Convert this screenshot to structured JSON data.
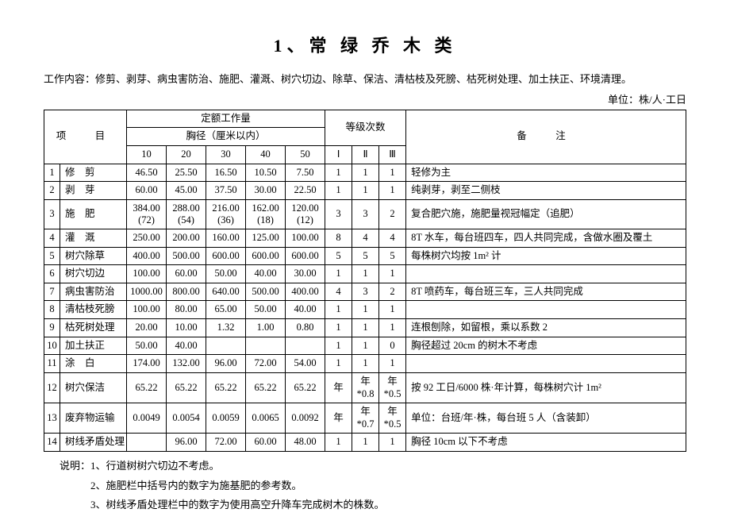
{
  "title": "1、常 绿 乔 木 类",
  "intro": "工作内容：修剪、剥芽、病虫害防治、施肥、灌溉、树穴切边、除草、保洁、清枯枝及死膀、枯死树处理、加土扶正、环境清理。",
  "unit": "单位：株/人·工日",
  "headers": {
    "project": "项　目",
    "quota": "定额工作量",
    "diameter": "胸径（厘米以内）",
    "grade": "等级次数",
    "note": "备　注",
    "d10": "10",
    "d20": "20",
    "d30": "30",
    "d40": "40",
    "d50": "50",
    "g1": "Ⅰ",
    "g2": "Ⅱ",
    "g3": "Ⅲ"
  },
  "chart_data": {
    "type": "table",
    "rows": [
      {
        "idx": "1",
        "name": "修　剪",
        "w": [
          "46.50",
          "25.50",
          "16.50",
          "10.50",
          "7.50"
        ],
        "g": [
          "1",
          "1",
          "1"
        ],
        "note": "轻修为主"
      },
      {
        "idx": "2",
        "name": "剥　芽",
        "w": [
          "60.00",
          "45.00",
          "37.50",
          "30.00",
          "22.50"
        ],
        "g": [
          "1",
          "1",
          "1"
        ],
        "note": "纯剥芽，剥至二侧枝"
      },
      {
        "idx": "3",
        "name": "施　肥",
        "w": [
          "384.00\n(72)",
          "288.00\n(54)",
          "216.00\n(36)",
          "162.00\n(18)",
          "120.00\n(12)"
        ],
        "g": [
          "3",
          "3",
          "2"
        ],
        "note": "复合肥穴施，施肥量视冠幅定（追肥）"
      },
      {
        "idx": "4",
        "name": "灌　溉",
        "w": [
          "250.00",
          "200.00",
          "160.00",
          "125.00",
          "100.00"
        ],
        "g": [
          "8",
          "4",
          "4"
        ],
        "note": "8T 水车，每台班四车，四人共同完成，含做水圈及覆土"
      },
      {
        "idx": "5",
        "name": "树穴除草",
        "w": [
          "400.00",
          "500.00",
          "600.00",
          "600.00",
          "600.00"
        ],
        "g": [
          "5",
          "5",
          "5"
        ],
        "note": "每株树穴均按 1m² 计"
      },
      {
        "idx": "6",
        "name": "树穴切边",
        "w": [
          "100.00",
          "60.00",
          "50.00",
          "40.00",
          "30.00"
        ],
        "g": [
          "1",
          "1",
          "1"
        ],
        "note": ""
      },
      {
        "idx": "7",
        "name": "病虫害防治",
        "w": [
          "1000.00",
          "800.00",
          "640.00",
          "500.00",
          "400.00"
        ],
        "g": [
          "4",
          "3",
          "2"
        ],
        "note": "8T 喷药车，每台班三车，三人共同完成"
      },
      {
        "idx": "8",
        "name": "清枯枝死膀",
        "w": [
          "100.00",
          "80.00",
          "65.00",
          "50.00",
          "40.00"
        ],
        "g": [
          "1",
          "1",
          "1"
        ],
        "note": ""
      },
      {
        "idx": "9",
        "name": "枯死树处理",
        "w": [
          "20.00",
          "10.00",
          "1.32",
          "1.00",
          "0.80"
        ],
        "g": [
          "1",
          "1",
          "1"
        ],
        "note": "连根刨除，如留根，乘以系数 2"
      },
      {
        "idx": "10",
        "name": "加土扶正",
        "w": [
          "50.00",
          "40.00",
          "",
          "",
          ""
        ],
        "g": [
          "1",
          "1",
          "0"
        ],
        "note": "胸径超过 20cm 的树木不考虑"
      },
      {
        "idx": "11",
        "name": "涂　白",
        "w": [
          "174.00",
          "132.00",
          "96.00",
          "72.00",
          "54.00"
        ],
        "g": [
          "1",
          "1",
          "1"
        ],
        "note": ""
      },
      {
        "idx": "12",
        "name": "树穴保洁",
        "w": [
          "65.22",
          "65.22",
          "65.22",
          "65.22",
          "65.22"
        ],
        "g": [
          "年",
          "年*0.8",
          "年*0.5"
        ],
        "note": "按 92 工日/6000 株·年计算，每株树穴计 1m²"
      },
      {
        "idx": "13",
        "name": "废弃物运输",
        "w": [
          "0.0049",
          "0.0054",
          "0.0059",
          "0.0065",
          "0.0092"
        ],
        "g": [
          "年",
          "年*0.7",
          "年*0.5"
        ],
        "note": "单位：台班/年·株，每台班 5 人（含装卸）"
      },
      {
        "idx": "14",
        "name": "树线矛盾处理",
        "w": [
          "",
          "96.00",
          "72.00",
          "60.00",
          "48.00"
        ],
        "g": [
          "1",
          "1",
          "1"
        ],
        "note": "胸径 10cm 以下不考虑"
      }
    ]
  },
  "notes": [
    "说明：1、行道树树穴切边不考虑。",
    "　　　2、施肥栏中括号内的数字为施基肥的参考数。",
    "　　　3、树线矛盾处理栏中的数字为使用高空升降车完成树木的株数。"
  ]
}
